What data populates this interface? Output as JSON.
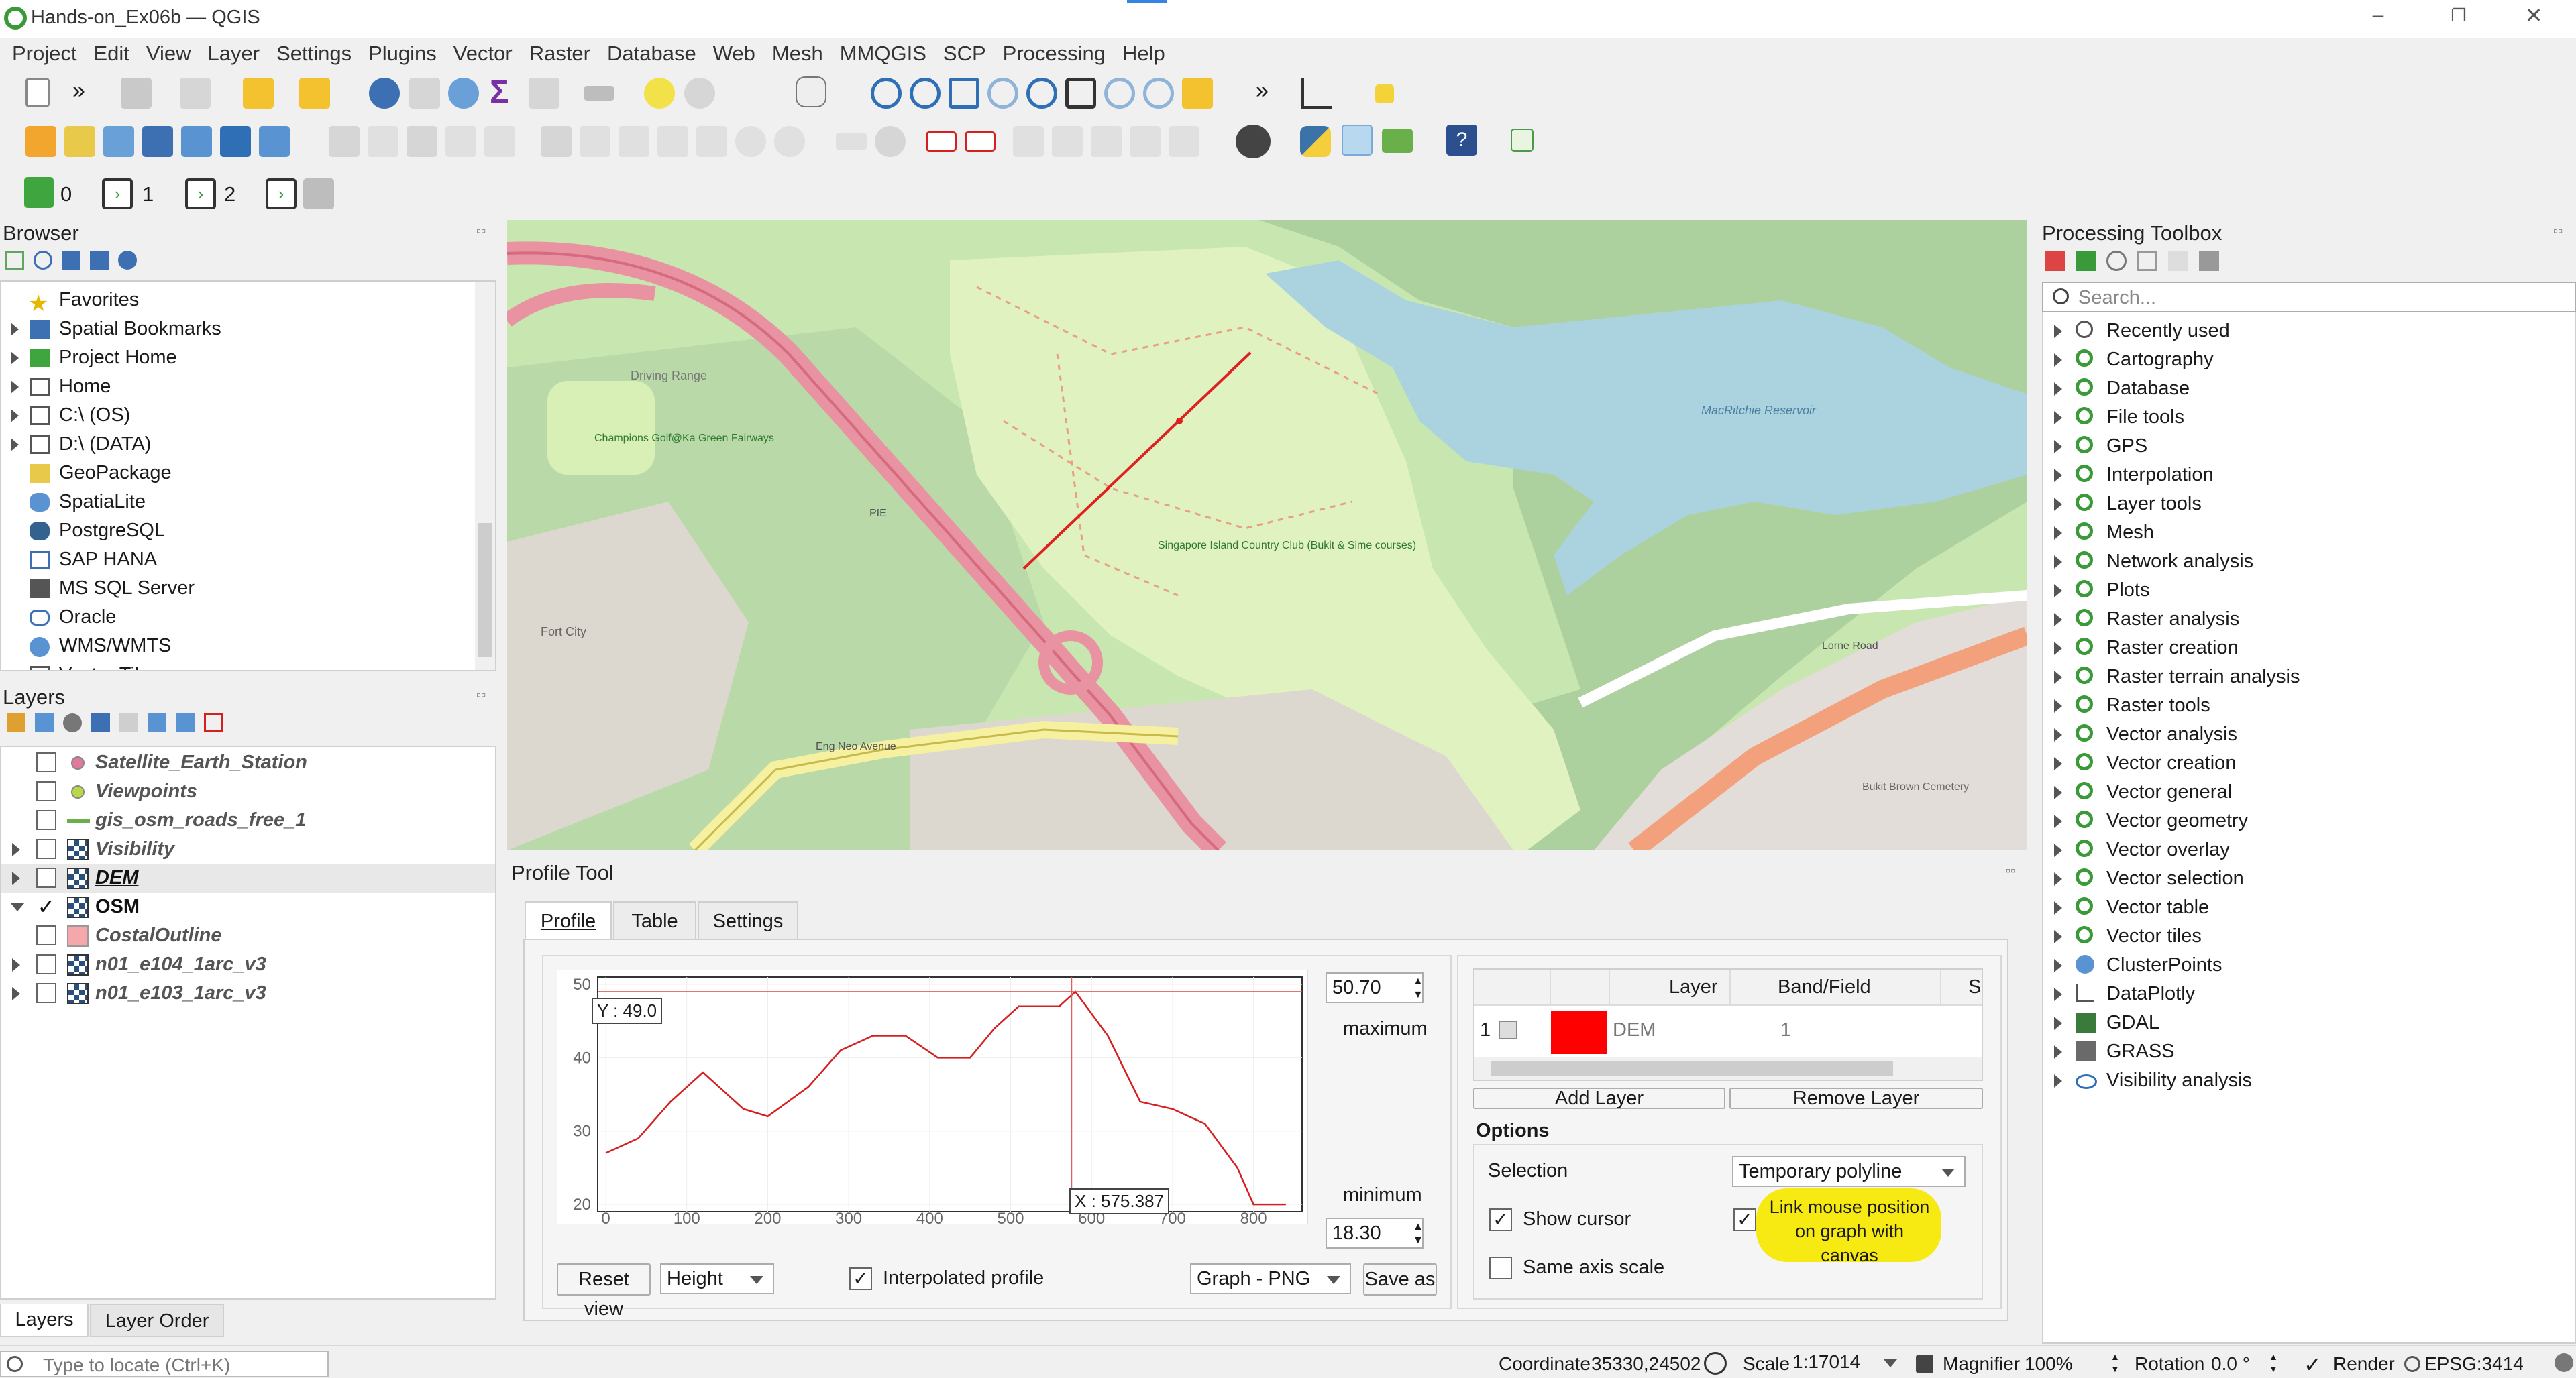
{
  "window": {
    "title": "Hands-on_Ex06b — QGIS"
  },
  "menu": [
    "Project",
    "Edit",
    "View",
    "Layer",
    "Settings",
    "Plugins",
    "Vector",
    "Raster",
    "Database",
    "Web",
    "Mesh",
    "MMQGIS",
    "SCP",
    "Processing",
    "Help"
  ],
  "toolbar": {
    "overflow": "»",
    "sigma": "Σ",
    "spin0": "0",
    "spin1": "1",
    "spin2": "2"
  },
  "browser": {
    "title": "Browser",
    "items": [
      "Favorites",
      "Spatial Bookmarks",
      "Project Home",
      "Home",
      "C:\\ (OS)",
      "D:\\ (DATA)",
      "GeoPackage",
      "SpatiaLite",
      "PostgreSQL",
      "SAP HANA",
      "MS SQL Server",
      "Oracle",
      "WMS/WMTS",
      "Vector Tiles"
    ]
  },
  "layers": {
    "title": "Layers",
    "items": [
      "Satellite_Earth_Station",
      "Viewpoints",
      "gis_osm_roads_free_1",
      "Visibility",
      "DEM",
      "OSM",
      "CostalOutline",
      "n01_e104_1arc_v3",
      "n01_e103_1arc_v3"
    ]
  },
  "map": {
    "labels": {
      "driving_range": "Driving Range",
      "champions": "Champions Golf@Ka Green Fairways",
      "pie": "PIE",
      "singapore": "Singapore Island Country Club (Bukit & Sime courses)",
      "macritchie": "MacRitchie Reservoir",
      "fort_city": "Fort City",
      "eng_neo": "Eng Neo Avenue",
      "lorne": "Lorne Road",
      "bukit_brown": "Bukit Brown Cemetery"
    }
  },
  "profile": {
    "title": "Profile Tool",
    "tabs": [
      "Profile",
      "Table",
      "Settings"
    ],
    "y_readout": "Y : 49.0",
    "x_readout": "X : 575.387",
    "max_value": "50.70",
    "max_label": "maximum",
    "min_value": "18.30",
    "min_label": "minimum",
    "reset_view": "Reset view",
    "mode": "Height",
    "interpolated": "Interpolated profile",
    "export_format": "Graph - PNG",
    "save_as": "Save as",
    "table_headers": [
      "Layer",
      "Band/Field",
      "Se"
    ],
    "row": {
      "index": "1",
      "layer": "DEM",
      "band": "1"
    },
    "add_layer": "Add Layer",
    "remove_layer": "Remove Layer",
    "options": "Options",
    "selection_label": "Selection",
    "selection_value": "Temporary polyline",
    "show_cursor": "Show cursor",
    "link_mouse": "Link mouse position on graph with canvas",
    "same_axis": "Same axis scale"
  },
  "chart_data": {
    "type": "line",
    "x": [
      0,
      40,
      80,
      120,
      170,
      200,
      250,
      290,
      330,
      370,
      410,
      450,
      480,
      510,
      560,
      580,
      620,
      660,
      700,
      740,
      780,
      800,
      840
    ],
    "y": [
      27,
      29,
      34,
      38,
      33,
      32,
      36,
      41,
      43,
      43,
      40,
      40,
      44,
      47,
      47,
      49,
      43,
      34,
      33,
      31,
      25,
      20,
      20
    ],
    "xlim": [
      -10,
      860
    ],
    "ylim": [
      19,
      51
    ],
    "xticks": [
      "0",
      "100",
      "200",
      "300",
      "400",
      "500",
      "600",
      "700",
      "800"
    ],
    "yticks": [
      "20",
      "30",
      "40",
      "50"
    ],
    "cursor_x": 575.387,
    "cursor_y": 49.0,
    "line_color": "#d42020"
  },
  "toolbox": {
    "title": "Processing Toolbox",
    "search_placeholder": "Search...",
    "items": [
      "Recently used",
      "Cartography",
      "Database",
      "File tools",
      "GPS",
      "Interpolation",
      "Layer tools",
      "Mesh",
      "Network analysis",
      "Plots",
      "Raster analysis",
      "Raster creation",
      "Raster terrain analysis",
      "Raster tools",
      "Vector analysis",
      "Vector creation",
      "Vector general",
      "Vector geometry",
      "Vector overlay",
      "Vector selection",
      "Vector table",
      "Vector tiles",
      "ClusterPoints",
      "DataPlotly",
      "GDAL",
      "GRASS",
      "Visibility analysis"
    ]
  },
  "bottom_tabs": [
    "Layers",
    "Layer Order"
  ],
  "statusbar": {
    "locate_placeholder": "Type to locate (Ctrl+K)",
    "coordinate_label": "Coordinate",
    "coordinate_value": "35330,24502",
    "scale_label": "Scale",
    "scale_value": "1:17014",
    "magnifier_label": "Magnifier",
    "magnifier_value": "100%",
    "rotation_label": "Rotation",
    "rotation_value": "0.0 °",
    "render_label": "Render",
    "crs": "EPSG:3414"
  },
  "colors": {
    "accent": "#ffee00",
    "line": "#d42020",
    "map_park": "#d8efb6",
    "map_water": "#aad3df",
    "map_forest": "#add19e",
    "map_road": "#e892a2"
  }
}
